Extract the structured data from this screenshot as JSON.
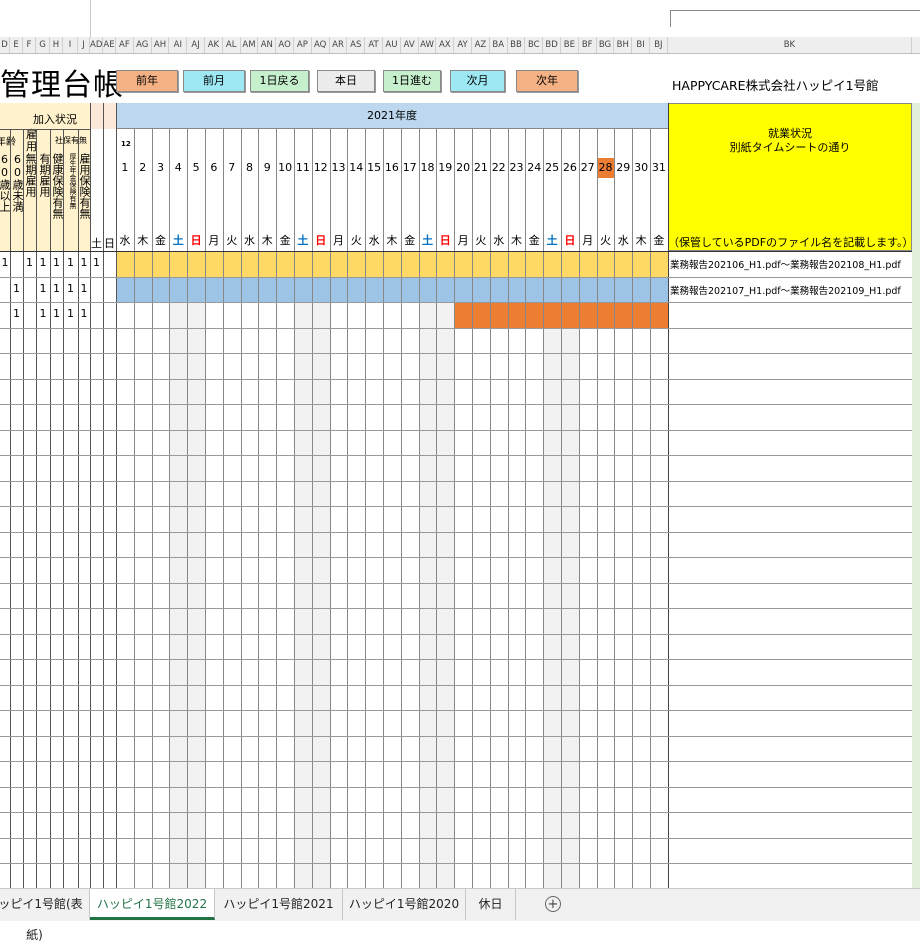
{
  "column_letters": {
    "left": [
      "D",
      "E",
      "F",
      "G",
      "H",
      "I",
      "J",
      "AD",
      "AE"
    ],
    "days": [
      "AF",
      "AG",
      "AH",
      "AI",
      "AJ",
      "AK",
      "AL",
      "AM",
      "AN",
      "AO",
      "AP",
      "AQ",
      "AR",
      "AS",
      "AT",
      "AU",
      "AV",
      "AW",
      "AX",
      "AY",
      "AZ",
      "BA",
      "BB",
      "BC",
      "BD",
      "BE",
      "BF",
      "BG",
      "BH",
      "BI",
      "BJ"
    ],
    "far": "BK"
  },
  "title": "管理台帳",
  "nav_buttons": [
    {
      "label": "前年",
      "color": "#f4b183"
    },
    {
      "label": "前月",
      "color": "#9ee8f4"
    },
    {
      "label": "1日戻る",
      "color": "#c6efce"
    },
    {
      "label": "本日",
      "color": "#ececec"
    },
    {
      "label": "1日進む",
      "color": "#c6efce"
    },
    {
      "label": "次月",
      "color": "#9ee8f4"
    },
    {
      "label": "次年",
      "color": "#f4b183"
    }
  ],
  "company": "HAPPYCARE株式会社ハッピイ1号館",
  "section_label": "加入状況",
  "age_label": "年齢",
  "koyo_label": "雇用",
  "shaho_label": "社保有無",
  "left_headers": [
    "60歳以上",
    "60歳未満",
    "無期雇用",
    "有期雇用",
    "健康保険有無",
    "厚生年金保険有無",
    "雇用保険有無"
  ],
  "weekend_headers": [
    "土",
    "日"
  ],
  "year_label": "2021年度",
  "month_label": "12",
  "days": [
    "1",
    "2",
    "3",
    "4",
    "5",
    "6",
    "7",
    "8",
    "9",
    "10",
    "11",
    "12",
    "13",
    "14",
    "15",
    "16",
    "17",
    "18",
    "19",
    "20",
    "21",
    "22",
    "23",
    "24",
    "25",
    "26",
    "27",
    "28",
    "29",
    "30",
    "31"
  ],
  "weekdays": [
    "水",
    "木",
    "金",
    "土",
    "日",
    "月",
    "火",
    "水",
    "木",
    "金",
    "土",
    "日",
    "月",
    "火",
    "水",
    "木",
    "金",
    "土",
    "日",
    "月",
    "火",
    "水",
    "木",
    "金",
    "土",
    "日",
    "月",
    "火",
    "水",
    "木",
    "金"
  ],
  "today_day": "28",
  "work_header": {
    "title": "就業状況",
    "subtitle": "別紙タイムシートの通り",
    "note": "（保管しているPDFのファイル名を記載します。）"
  },
  "rows": [
    {
      "values": [
        "1",
        "",
        "1",
        "1",
        "1",
        "1",
        "1",
        "1"
      ],
      "note": "業務報告202106_H1.pdf～業務報告202108_H1.pdf",
      "fill": "#ffd966",
      "fill_from": 1
    },
    {
      "values": [
        "",
        "1",
        "",
        "1",
        "1",
        "1",
        "1",
        ""
      ],
      "note": "業務報告202107_H1.pdf～業務報告202109_H1.pdf",
      "fill": "#9dc3e6",
      "fill_from": 1
    },
    {
      "values": [
        "",
        "1",
        "",
        "1",
        "1",
        "1",
        "1",
        ""
      ],
      "note": "",
      "fill": "#ed7d31",
      "fill_from": 20
    }
  ],
  "tabs": [
    "ハッピイ1号館(表紙)",
    "ハッピイ1号館2022",
    "ハッピイ1号館2021",
    "ハッピイ1号館2020",
    "休日"
  ],
  "active_tab": "ハッピイ1号館2022",
  "colors": {
    "header_blue": "#bdd7ee",
    "header_yellow": "#ffff00",
    "left_header": "#fff2cc",
    "today": "#ed7d31",
    "sunday": "#ff0000",
    "saturday": "#0070c0",
    "weekend_column": "#f2f2f2"
  }
}
